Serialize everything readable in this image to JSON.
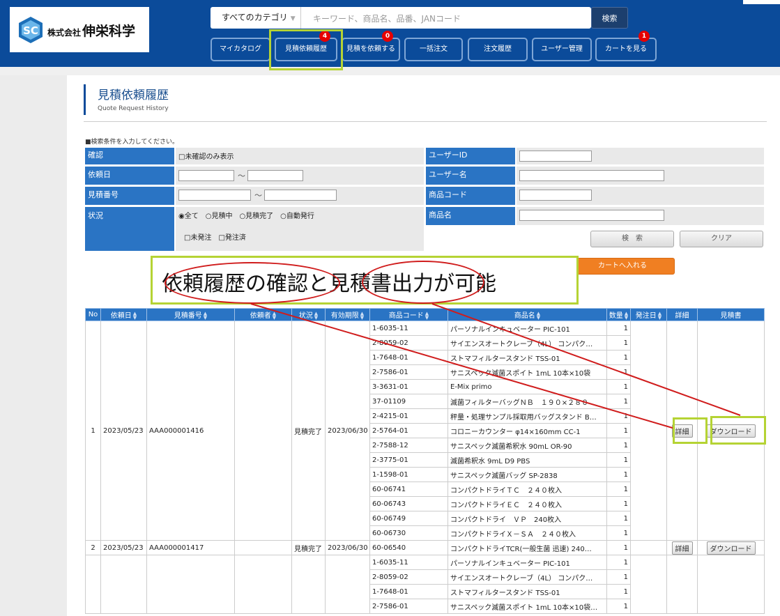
{
  "header": {
    "logo_prefix": "株式会社",
    "logo_name": "伸栄科学",
    "search_category": "すべてのカテゴリ",
    "search_placeholder": "キーワード、商品名、品番、JANコード",
    "search_button": "検索",
    "nav": [
      {
        "label": "マイカタログ",
        "badge": ""
      },
      {
        "label": "見積依頼履歴",
        "badge": "4"
      },
      {
        "label": "見積を依頼する",
        "badge": "0"
      },
      {
        "label": "一括注文",
        "badge": ""
      },
      {
        "label": "注文履歴",
        "badge": ""
      },
      {
        "label": "ユーザー管理",
        "badge": ""
      },
      {
        "label": "カートを見る",
        "badge": "1"
      }
    ]
  },
  "page": {
    "title": "見積依頼履歴",
    "subtitle": "Quote Request History",
    "hint": "■検索条件を入力してください。"
  },
  "form": {
    "confirm_label": "確認",
    "confirm_option": "□未確認のみ表示",
    "request_date_label": "依頼日",
    "quote_no_label": "見積番号",
    "tilde": "～",
    "status_label": "状況",
    "status_options": "◉全て　○見積中　○見積完了　○自動発行",
    "order_options": "□未発注　□発注済",
    "user_id_label": "ユーザーID",
    "user_name_label": "ユーザー名",
    "product_code_label": "商品コード",
    "product_name_label": "商品名",
    "search_button": "検　索",
    "clear_button": "クリア",
    "cart_button": "カートへ入れる"
  },
  "callout": {
    "text": "依頼履歴の確認と見積書出力が可能",
    "color": "#b5d334",
    "ellipse_color": "#d01c1c"
  },
  "table": {
    "headers": [
      "No",
      "依頼日",
      "見積番号",
      "依頼者",
      "状況",
      "有効期限",
      "商品コード",
      "商品名",
      "数量",
      "発注日",
      "詳細",
      "見積書"
    ],
    "detail_button": "詳細",
    "download_button": "ダウンロード",
    "orders": [
      {
        "no": "1",
        "date": "2023/05/23",
        "quote": "AAA000001416",
        "requester": "",
        "status": "見積完了",
        "expiry": "2023/06/30",
        "items": [
          {
            "code": "1-6035-11",
            "name": "パーソナルインキュベーター PIC-101",
            "qty": "1"
          },
          {
            "code": "2-8059-02",
            "name": "サイエンスオートクレーブ（4L） コンパク…",
            "qty": "1"
          },
          {
            "code": "1-7648-01",
            "name": "ストマフィルタースタンド TSS-01",
            "qty": "1"
          },
          {
            "code": "2-7586-01",
            "name": "サニスペック滅菌スポイト 1mL 10本×10袋",
            "qty": "1"
          },
          {
            "code": "3-3631-01",
            "name": "E-Mix primo",
            "qty": "1"
          },
          {
            "code": "37-01109",
            "name": "滅菌フィルターバッグＮＢ　１９０×２８０",
            "qty": "1"
          },
          {
            "code": "2-4215-01",
            "name": "秤量・処理サンプル採取用バッグスタンド B…",
            "qty": "1"
          },
          {
            "code": "2-5764-01",
            "name": "コロニーカウンター φ14×160mm CC-1",
            "qty": "1"
          },
          {
            "code": "2-7588-12",
            "name": "サニスペック滅菌希釈水 90mL OR-90",
            "qty": "1"
          },
          {
            "code": "2-3775-01",
            "name": "滅菌希釈水 9mL D9 PBS",
            "qty": "1"
          },
          {
            "code": "1-1598-01",
            "name": "サニスペック滅菌バッグ SP-2838",
            "qty": "1"
          },
          {
            "code": "60-06741",
            "name": "コンパクトドライＴＣ　２４０枚入",
            "qty": "1"
          },
          {
            "code": "60-06743",
            "name": "コンパクトドライＥＣ　２４０枚入",
            "qty": "1"
          },
          {
            "code": "60-06749",
            "name": "コンパクトドライ　ＶＰ　240枚入",
            "qty": "1"
          },
          {
            "code": "60-06730",
            "name": "コンパクトドライＸ－ＳＡ　２４０枚入",
            "qty": "1"
          }
        ]
      },
      {
        "no": "2",
        "date": "2023/05/23",
        "quote": "AAA000001417",
        "requester": "",
        "status": "見積完了",
        "expiry": "2023/06/30",
        "items": [
          {
            "code": "60-06540",
            "name": "コンパクトドライTCR(一般生菌 迅速) 240…",
            "qty": "1"
          }
        ]
      },
      {
        "no": "",
        "date": "",
        "quote": "",
        "requester": "",
        "status": "",
        "expiry": "",
        "items": [
          {
            "code": "1-6035-11",
            "name": "パーソナルインキュベーター PIC-101",
            "qty": "1"
          },
          {
            "code": "2-8059-02",
            "name": "サイエンスオートクレーブ（4L） コンパク…",
            "qty": "1"
          },
          {
            "code": "1-7648-01",
            "name": "ストマフィルタースタンド TSS-01",
            "qty": "1"
          },
          {
            "code": "2-7586-01",
            "name": "サニスペック滅菌スポイト 1mL 10本×10袋…",
            "qty": "1"
          }
        ]
      }
    ]
  }
}
